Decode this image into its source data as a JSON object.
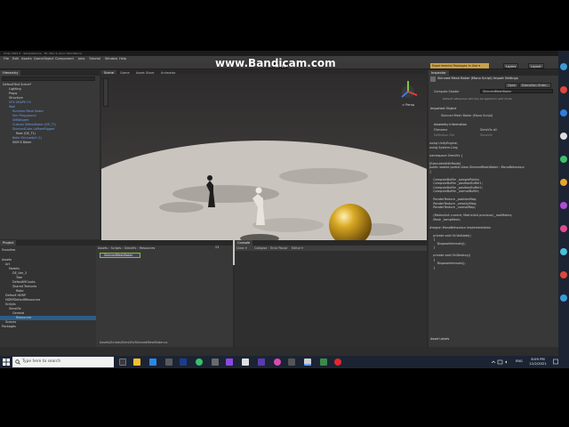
{
  "watermark": "www.Bandicam.com",
  "app": {
    "title": "Unity 2021.2 - SampleScene - PC, Mac & Linux Standalone",
    "menu": [
      "File",
      "Edit",
      "Assets",
      "GameObject",
      "Component",
      "Jobs",
      "Tutorial",
      "Window",
      "Help"
    ],
    "experimental_label": "Experimental Packages In Use ▾",
    "layers_label": "Layers",
    "layout_label": "Layout"
  },
  "hierarchy": {
    "tab": "Hierarchy",
    "items": [
      {
        "label": "DefaultTest Scene*",
        "color": "normal"
      },
      {
        "label": "Lighting",
        "color": "normal"
      },
      {
        "label": "Props",
        "color": "normal"
      },
      {
        "label": "Structure",
        "color": "normal"
      },
      {
        "label": "VFX GRAPH FX",
        "color": "blue"
      },
      {
        "label": "Wall",
        "color": "blue"
      },
      {
        "label": "Runtime Mesh Baker",
        "color": "blue"
      },
      {
        "label": "Sim Playground",
        "color": "blue"
      },
      {
        "label": "SMWidgetr",
        "color": "blue"
      },
      {
        "label": "Custom SMeshBaker (DE_T1)",
        "color": "blue"
      },
      {
        "label": "SkinnedCube-LaPoseRigged",
        "color": "blue"
      },
      {
        "label": "Root (DE_T1)",
        "color": "normal"
      },
      {
        "label": "Bake Skinnedp3 (1)",
        "color": "blue"
      },
      {
        "label": "SKM B Baker",
        "color": "normal"
      }
    ]
  },
  "scene": {
    "tabs": [
      "Scene",
      "Game",
      "Asset Store",
      "Animator"
    ],
    "persp_label": "< Persp"
  },
  "project": {
    "tabs": [
      "Project",
      "Console"
    ],
    "tree": [
      "Favorites",
      "Assets",
      "Art",
      "Models",
      "DE_tier_3",
      "Tree",
      "DefaultMCooks",
      "Shared Textures",
      "Robo",
      "Default HDRP",
      "HDRPDefaultResources",
      "Scripts",
      "SimsVfx",
      "General",
      "Resources",
      "Scenes",
      "Packages"
    ],
    "breadcrumb": [
      "Assets",
      "Scripts",
      "SimsVfx",
      "Resources"
    ],
    "asset_name": "SkinnedMeshBaker",
    "path": "Assets/Scripts/SimsVfx/SkinnedMeshBaker.cs",
    "count": "23"
  },
  "console": {
    "tab": "Console",
    "toolbar": [
      "Clear ▾",
      "Collapse",
      "Error Pause",
      "Editor ▾"
    ]
  },
  "inspector": {
    "tab": "Inspector",
    "header": "Skinned Mesh Baker (Mono Script) Import Settings",
    "open_btn": "Open",
    "exec_btn": "Execution Order...",
    "compute_label": "Compute Shader",
    "compute_value": "SkinnedMeshBaker",
    "note": "Default references will only be applied in edit mode.",
    "imported_label": "Imported Object",
    "imported_name": "Skinned Mesh Baker (Mono Script)",
    "assembly_label": "Assembly Information",
    "filename_label": "Filename",
    "filename_value": "SimsVfx.dll",
    "def_label": "Definition File",
    "def_value": "SimsVfx",
    "code": "using UnityEngine;\nusing System.Linq;\n\nnamespace SimsVfx {\n\n[ExecuteInEditMode]\npublic sealed partial class SkinnedMeshBaker : MonoBehaviour\n{\n\n    ComputeBuffer _samplePoints;\n    ComputeBuffer _positionBuffer1;\n    ComputeBuffer _positionBuffer2;\n    ComputeBuffer _normalBuffer;\n\n    RenderTexture _positionMap;\n    RenderTexture _velocityMap;\n    RenderTexture _normalMap;\n\n    (Matrix4x4 current, Matrix4x4 previous) _rootMatrix;\n    Mesh _tempMesh;\n\n#region MonoBehaviour implementation\n\n    private void OnValidate()\n    {\n        DisposeInternals();\n    }\n\n    private void OnDestroy()\n    {\n        DisposeInternals();\n    }\n",
    "asset_labels": "Asset Labels"
  },
  "taskbar": {
    "search_placeholder": "Type here to search",
    "time": "8:09 PM",
    "date": "12/2/2021",
    "lang": "ENG"
  }
}
